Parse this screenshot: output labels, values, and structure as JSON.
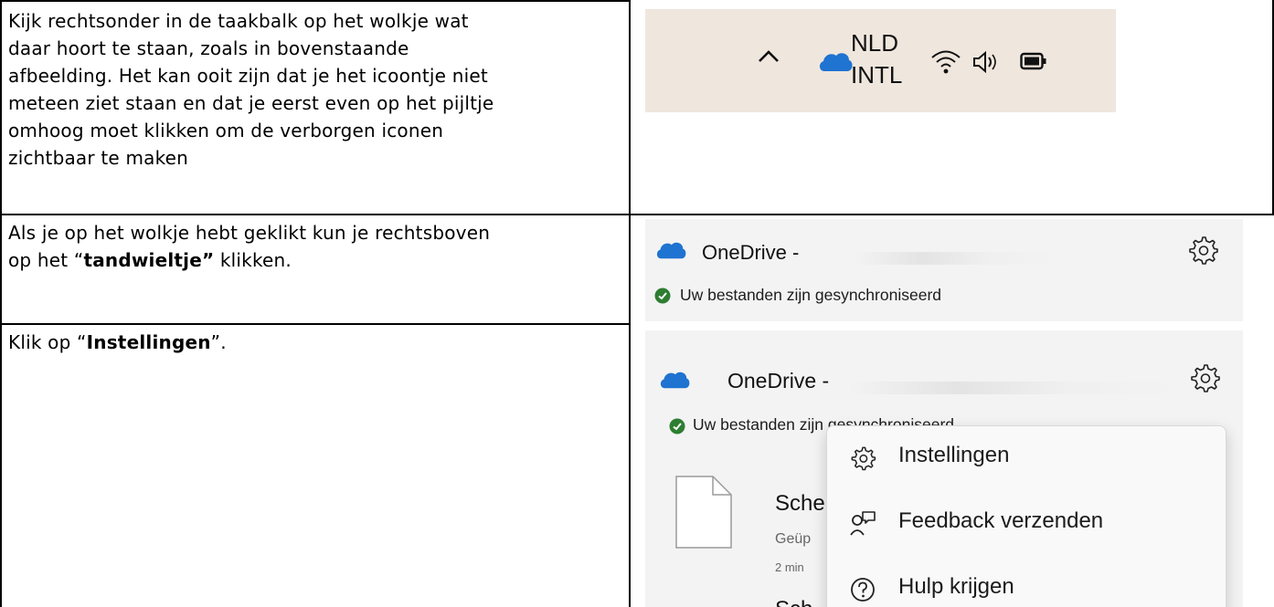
{
  "rows": [
    {
      "text_plain": "Kijk rechtsonder in de taakbalk op het wolkje wat daar hoort te staan, zoals in bovenstaande afbeelding. Het kan ooit zijn dat je het icoontje niet meteen ziet staan en dat je eerst even op het pijltje omhoog moet klikken om de verborgen iconen zichtbaar te maken",
      "lines": [
        "Kijk rechtsonder in de taakbalk op het wolkje wat",
        "daar hoort te staan, zoals in bovenstaande",
        "afbeelding. Het kan ooit zijn dat je het icoontje niet",
        "meteen ziet staan en dat je eerst even op het pijltje",
        "omhoog moet klikken om de verborgen iconen",
        "zichtbaar te maken"
      ]
    },
    {
      "line1": "Als je op het wolkje hebt geklikt kun je rechtsboven",
      "line2_pre": "op het “",
      "line2_bold": "tandwieltje”",
      "line2_post": " klikken."
    },
    {
      "pre": "Klik op “",
      "bold": "Instellingen",
      "post": "”."
    }
  ],
  "taskbar": {
    "lang_line1": "NLD",
    "lang_line2": "INTL",
    "icons": [
      "chevron-up-icon",
      "onedrive-cloud-icon",
      "wifi-icon",
      "volume-icon",
      "battery-icon"
    ]
  },
  "onedrive_panel": {
    "title": "OneDrive -",
    "title_short": "OneDrive -",
    "status": "Uw bestanden zijn gesynchroniseerd",
    "status_partial": "Uw bestanden zijn gesynchroniseerd",
    "file_name_partial": "Sche",
    "file_meta_partial": "Geüp",
    "file_time_partial": "2 min",
    "file2_partial": "Sch"
  },
  "context_menu": {
    "items": [
      {
        "label": "Instellingen",
        "icon": "gear-icon"
      },
      {
        "label": "Feedback verzenden",
        "icon": "feedback-icon"
      },
      {
        "label": "Hulp krijgen",
        "icon": "help-icon"
      }
    ]
  },
  "colors": {
    "taskbar_bg": "#efe6dd",
    "panel_bg": "#f3f3f3",
    "onedrive_blue": "#1f73d1",
    "sync_green": "#2e7d32",
    "grid_line": "#000000"
  }
}
